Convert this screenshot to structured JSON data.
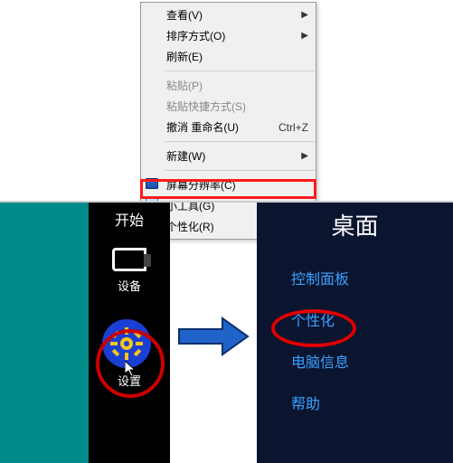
{
  "context_menu": {
    "view": "查看(V)",
    "sort": "排序方式(O)",
    "refresh": "刷新(E)",
    "paste": "粘贴(P)",
    "paste_shortcut": "粘贴快捷方式(S)",
    "undo_rename": "撤消 重命名(U)",
    "undo_shortcut": "Ctrl+Z",
    "new": "新建(W)",
    "resolution": "屏幕分辨率(C)",
    "gadgets": "小工具(G)",
    "personalize": "个性化(R)"
  },
  "charm": {
    "title": "开始",
    "devices": "设备",
    "settings": "设置"
  },
  "desktop": {
    "title": "桌面",
    "links": [
      "控制面板",
      "个性化",
      "电脑信息",
      "帮助"
    ]
  }
}
